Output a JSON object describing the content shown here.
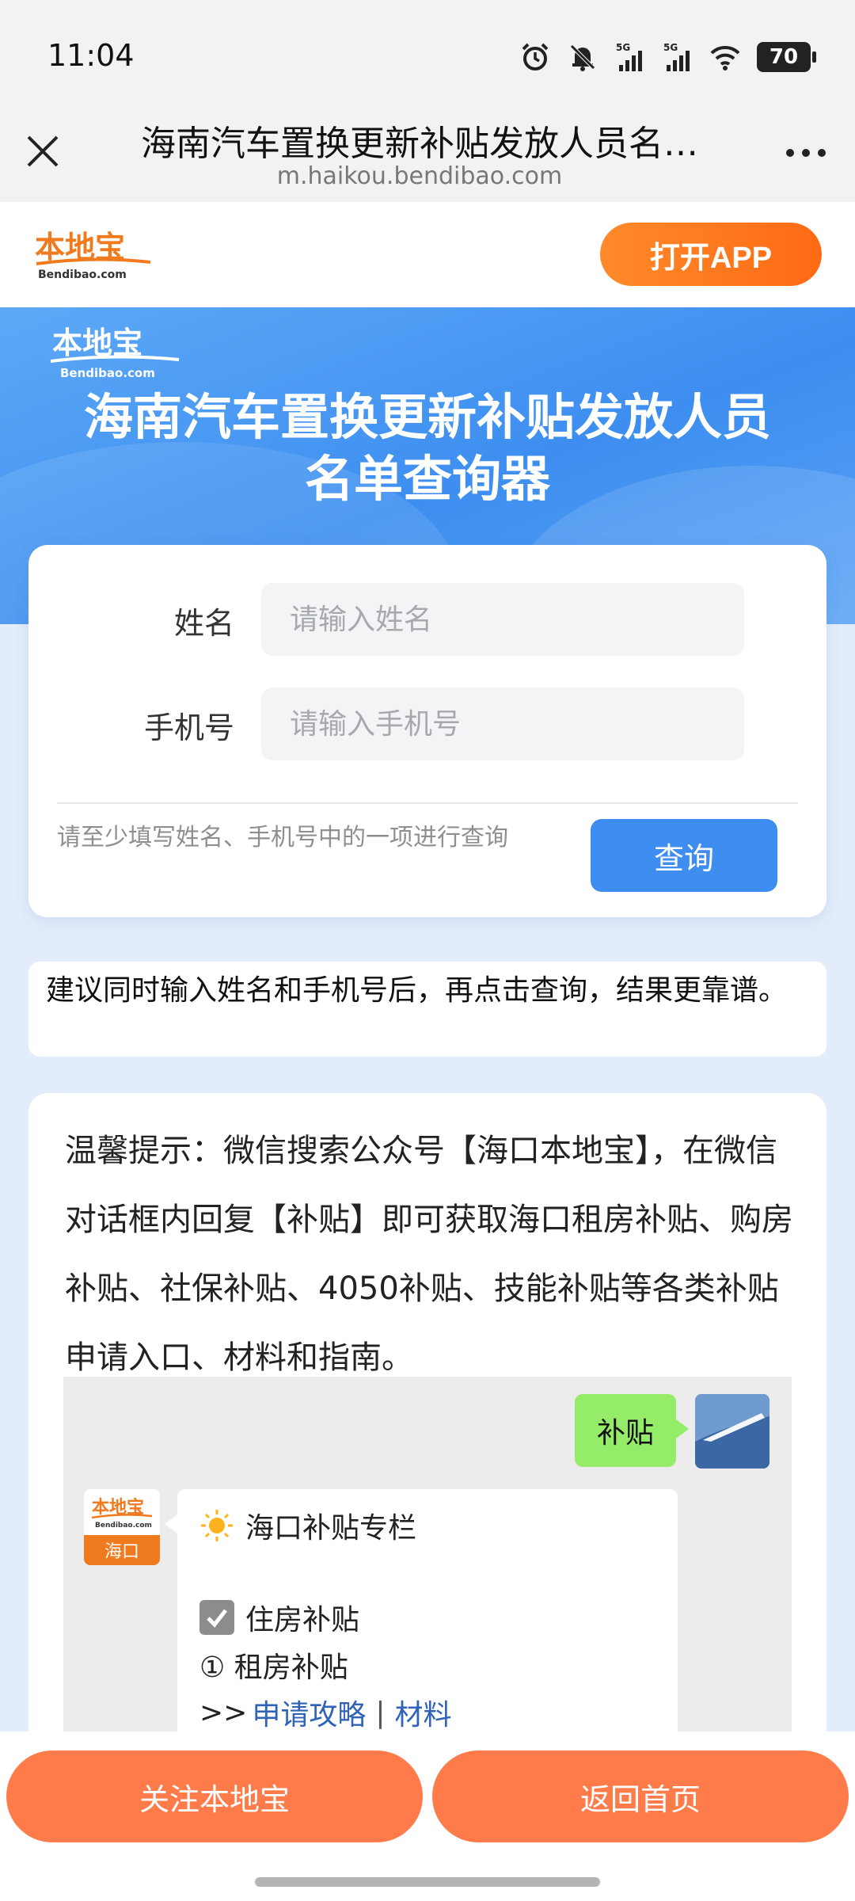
{
  "status_bar": {
    "time": "11:04",
    "icons": [
      "alarm-icon",
      "mute-icon",
      "5g-signal-icon",
      "5g-signal-icon",
      "wifi-icon"
    ],
    "signal_label_1": "5G",
    "signal_label_2": "5G",
    "battery": "70"
  },
  "browser": {
    "title": "海南汽车置换更新补贴发放人员名…",
    "url": "m.haikou.bendibao.com"
  },
  "site_header": {
    "logo_text": "本地宝",
    "logo_sub": "Bendibao.com",
    "open_app_label": "打开APP"
  },
  "banner": {
    "logo_text": "本地宝",
    "logo_sub": "Bendibao.com",
    "title_line1": "海南汽车置换更新补贴发放人员",
    "title_line2": "名单查询器"
  },
  "form": {
    "name_label": "姓名",
    "name_placeholder": "请输入姓名",
    "phone_label": "手机号",
    "phone_placeholder": "请输入手机号",
    "hint": "请至少填写姓名、手机号中的一项进行查询",
    "query_label": "查询"
  },
  "advice": {
    "text": "建议同时输入姓名和手机号后，再点击查询，结果更靠谱。"
  },
  "tips": {
    "text": "温馨提示：微信搜索公众号【海口本地宝】，在微信对话框内回复【补贴】即可获取海口租房补贴、购房补贴、社保补贴、4050补贴、技能补贴等各类补贴申请入口、材料和指南。",
    "chat": {
      "my_message": "补贴",
      "them_avatar_text": "本地宝",
      "them_avatar_sub": "Bendibao.com",
      "them_avatar_city": "海口",
      "reply_title": "海口补贴专栏",
      "reply_section": "住房补贴",
      "reply_item": "① 租房补贴",
      "reply_prefix": ">>",
      "reply_link1": "申请攻略",
      "reply_sep": "|",
      "reply_link2": "材料"
    }
  },
  "bottom_bar": {
    "follow_label": "关注本地宝",
    "home_label": "返回首页"
  },
  "colors": {
    "accent_orange": "#ff7c4a",
    "brand_blue": "#3d8ef0",
    "chat_green": "#95ec69"
  }
}
